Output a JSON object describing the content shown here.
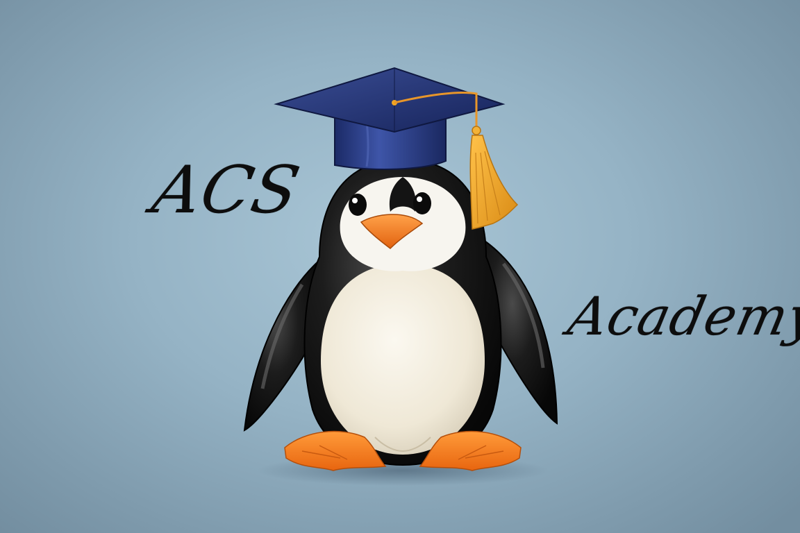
{
  "logo": {
    "line_1": "ACS",
    "line_2": "Academy"
  },
  "illustration": {
    "subject": "penguin-with-graduation-cap",
    "colors": {
      "background": "#95b3c5",
      "cap": "#1e2f6b",
      "tassel": "#f0a020",
      "beak_feet": "#f5821f",
      "body_dark": "#141414",
      "belly": "#f3ede0"
    }
  }
}
